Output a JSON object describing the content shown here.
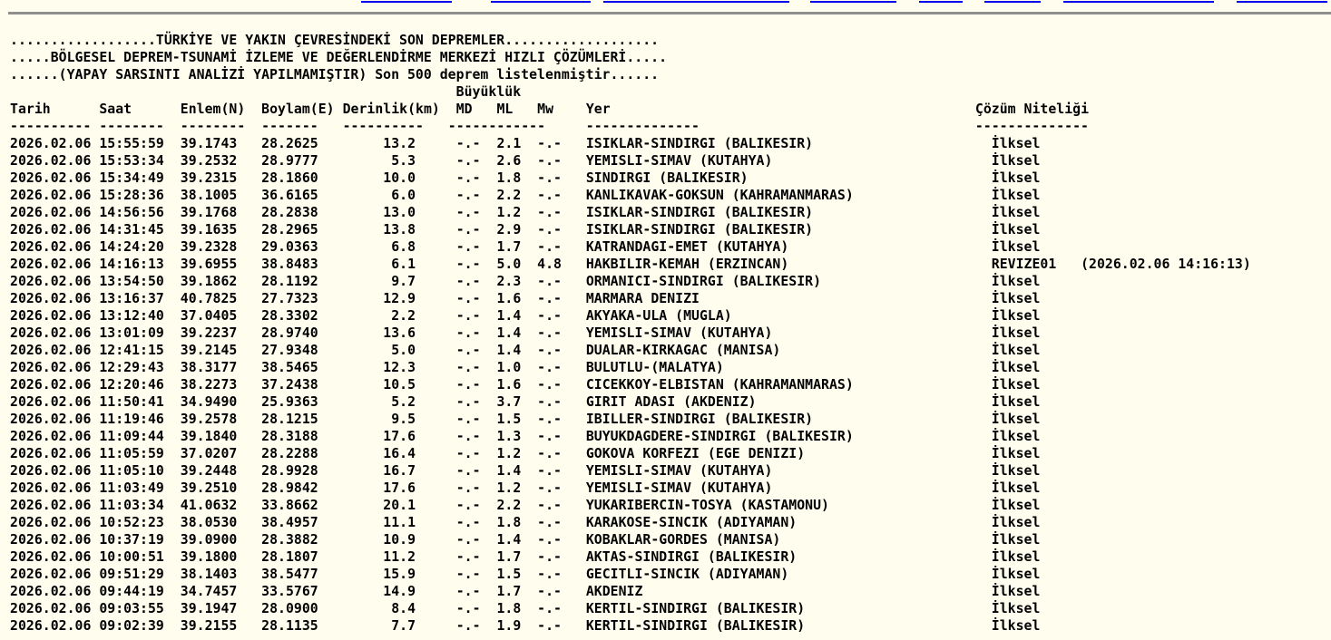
{
  "header": {
    "line1": "..................TÜRKİYE VE YAKIN ÇEVRESİNDEKİ SON DEPREMLER...................",
    "line2": ".....BÖLGESEL DEPREM-TSUNAMİ İZLEME VE DEĞERLENDİRME MERKEZİ HIZLI ÇÖZÜMLERİ.....",
    "line3": "......(YAPAY SARSINTI ANALİZİ YAPILMAMIŞTIR) Son 500 deprem listelenmiştir......"
  },
  "columns": {
    "magnitude_group": "Büyüklük",
    "tarih": "Tarih",
    "saat": "Saat",
    "enlem": "Enlem(N)",
    "boylam": "Boylam(E)",
    "derinlik": "Derinlik(km)",
    "md": "MD",
    "ml": "ML",
    "mw": "Mw",
    "yer": "Yer",
    "cozum": "Çözüm Niteliği"
  },
  "rows": [
    {
      "date": "2026.02.06",
      "time": "15:55:59",
      "lat": "39.1743",
      "lon": "28.2625",
      "depth": "13.2",
      "md": "-.-",
      "ml": "2.1",
      "mw": "-.-",
      "place": "ISIKLAR-SINDIRGI (BALIKESIR)",
      "quality": "İlksel"
    },
    {
      "date": "2026.02.06",
      "time": "15:53:34",
      "lat": "39.2532",
      "lon": "28.9777",
      "depth": "5.3",
      "md": "-.-",
      "ml": "2.6",
      "mw": "-.-",
      "place": "YEMISLI-SIMAV (KUTAHYA)",
      "quality": "İlksel"
    },
    {
      "date": "2026.02.06",
      "time": "15:34:49",
      "lat": "39.2315",
      "lon": "28.1860",
      "depth": "10.0",
      "md": "-.-",
      "ml": "1.8",
      "mw": "-.-",
      "place": "SINDIRGI (BALIKESIR)",
      "quality": "İlksel"
    },
    {
      "date": "2026.02.06",
      "time": "15:28:36",
      "lat": "38.1005",
      "lon": "36.6165",
      "depth": "6.0",
      "md": "-.-",
      "ml": "2.2",
      "mw": "-.-",
      "place": "KANLIKAVAK-GOKSUN (KAHRAMANMARAS)",
      "quality": "İlksel"
    },
    {
      "date": "2026.02.06",
      "time": "14:56:56",
      "lat": "39.1768",
      "lon": "28.2838",
      "depth": "13.0",
      "md": "-.-",
      "ml": "1.2",
      "mw": "-.-",
      "place": "ISIKLAR-SINDIRGI (BALIKESIR)",
      "quality": "İlksel"
    },
    {
      "date": "2026.02.06",
      "time": "14:31:45",
      "lat": "39.1635",
      "lon": "28.2965",
      "depth": "13.8",
      "md": "-.-",
      "ml": "2.9",
      "mw": "-.-",
      "place": "ISIKLAR-SINDIRGI (BALIKESIR)",
      "quality": "İlksel"
    },
    {
      "date": "2026.02.06",
      "time": "14:24:20",
      "lat": "39.2328",
      "lon": "29.0363",
      "depth": "6.8",
      "md": "-.-",
      "ml": "1.7",
      "mw": "-.-",
      "place": "KATRANDAGI-EMET (KUTAHYA)",
      "quality": "İlksel"
    },
    {
      "date": "2026.02.06",
      "time": "14:16:13",
      "lat": "39.6955",
      "lon": "38.8483",
      "depth": "6.1",
      "md": "-.-",
      "ml": "5.0",
      "mw": "4.8",
      "place": "HAKBILIR-KEMAH (ERZINCAN)",
      "quality": "REVIZE01   (2026.02.06 14:16:13)"
    },
    {
      "date": "2026.02.06",
      "time": "13:54:50",
      "lat": "39.1862",
      "lon": "28.1192",
      "depth": "9.7",
      "md": "-.-",
      "ml": "2.3",
      "mw": "-.-",
      "place": "ORMANICI-SINDIRGI (BALIKESIR)",
      "quality": "İlksel"
    },
    {
      "date": "2026.02.06",
      "time": "13:16:37",
      "lat": "40.7825",
      "lon": "27.7323",
      "depth": "12.9",
      "md": "-.-",
      "ml": "1.6",
      "mw": "-.-",
      "place": "MARMARA DENIZI",
      "quality": "İlksel"
    },
    {
      "date": "2026.02.06",
      "time": "13:12:40",
      "lat": "37.0405",
      "lon": "28.3302",
      "depth": "2.2",
      "md": "-.-",
      "ml": "1.4",
      "mw": "-.-",
      "place": "AKYAKA-ULA (MUGLA)",
      "quality": "İlksel"
    },
    {
      "date": "2026.02.06",
      "time": "13:01:09",
      "lat": "39.2237",
      "lon": "28.9740",
      "depth": "13.6",
      "md": "-.-",
      "ml": "1.4",
      "mw": "-.-",
      "place": "YEMISLI-SIMAV (KUTAHYA)",
      "quality": "İlksel"
    },
    {
      "date": "2026.02.06",
      "time": "12:41:15",
      "lat": "39.2145",
      "lon": "27.9348",
      "depth": "5.0",
      "md": "-.-",
      "ml": "1.4",
      "mw": "-.-",
      "place": "DUALAR-KIRKAGAC (MANISA)",
      "quality": "İlksel"
    },
    {
      "date": "2026.02.06",
      "time": "12:29:43",
      "lat": "38.3177",
      "lon": "38.5465",
      "depth": "12.3",
      "md": "-.-",
      "ml": "1.0",
      "mw": "-.-",
      "place": "BULUTLU-(MALATYA)",
      "quality": "İlksel"
    },
    {
      "date": "2026.02.06",
      "time": "12:20:46",
      "lat": "38.2273",
      "lon": "37.2438",
      "depth": "10.5",
      "md": "-.-",
      "ml": "1.6",
      "mw": "-.-",
      "place": "CICEKKOY-ELBISTAN (KAHRAMANMARAS)",
      "quality": "İlksel"
    },
    {
      "date": "2026.02.06",
      "time": "11:50:41",
      "lat": "34.9490",
      "lon": "25.9363",
      "depth": "5.2",
      "md": "-.-",
      "ml": "3.7",
      "mw": "-.-",
      "place": "GIRIT ADASI (AKDENIZ)",
      "quality": "İlksel"
    },
    {
      "date": "2026.02.06",
      "time": "11:19:46",
      "lat": "39.2578",
      "lon": "28.1215",
      "depth": "9.5",
      "md": "-.-",
      "ml": "1.5",
      "mw": "-.-",
      "place": "IBILLER-SINDIRGI (BALIKESIR)",
      "quality": "İlksel"
    },
    {
      "date": "2026.02.06",
      "time": "11:09:44",
      "lat": "39.1840",
      "lon": "28.3188",
      "depth": "17.6",
      "md": "-.-",
      "ml": "1.3",
      "mw": "-.-",
      "place": "BUYUKDAGDERE-SINDIRGI (BALIKESIR)",
      "quality": "İlksel"
    },
    {
      "date": "2026.02.06",
      "time": "11:05:59",
      "lat": "37.0207",
      "lon": "28.2288",
      "depth": "16.4",
      "md": "-.-",
      "ml": "1.2",
      "mw": "-.-",
      "place": "GOKOVA KORFEZI (EGE DENIZI)",
      "quality": "İlksel"
    },
    {
      "date": "2026.02.06",
      "time": "11:05:10",
      "lat": "39.2448",
      "lon": "28.9928",
      "depth": "16.7",
      "md": "-.-",
      "ml": "1.4",
      "mw": "-.-",
      "place": "YEMISLI-SIMAV (KUTAHYA)",
      "quality": "İlksel"
    },
    {
      "date": "2026.02.06",
      "time": "11:03:49",
      "lat": "39.2510",
      "lon": "28.9842",
      "depth": "17.6",
      "md": "-.-",
      "ml": "1.2",
      "mw": "-.-",
      "place": "YEMISLI-SIMAV (KUTAHYA)",
      "quality": "İlksel"
    },
    {
      "date": "2026.02.06",
      "time": "11:03:34",
      "lat": "41.0632",
      "lon": "33.8662",
      "depth": "20.1",
      "md": "-.-",
      "ml": "2.2",
      "mw": "-.-",
      "place": "YUKARIBERCIN-TOSYA (KASTAMONU)",
      "quality": "İlksel"
    },
    {
      "date": "2026.02.06",
      "time": "10:52:23",
      "lat": "38.0530",
      "lon": "38.4957",
      "depth": "11.1",
      "md": "-.-",
      "ml": "1.8",
      "mw": "-.-",
      "place": "KARAKOSE-SINCIK (ADIYAMAN)",
      "quality": "İlksel"
    },
    {
      "date": "2026.02.06",
      "time": "10:37:19",
      "lat": "39.0900",
      "lon": "28.3882",
      "depth": "10.9",
      "md": "-.-",
      "ml": "1.4",
      "mw": "-.-",
      "place": "KOBAKLAR-GORDES (MANISA)",
      "quality": "İlksel"
    },
    {
      "date": "2026.02.06",
      "time": "10:00:51",
      "lat": "39.1800",
      "lon": "28.1807",
      "depth": "11.2",
      "md": "-.-",
      "ml": "1.7",
      "mw": "-.-",
      "place": "AKTAS-SINDIRGI (BALIKESIR)",
      "quality": "İlksel"
    },
    {
      "date": "2026.02.06",
      "time": "09:51:29",
      "lat": "38.1403",
      "lon": "38.5477",
      "depth": "15.9",
      "md": "-.-",
      "ml": "1.5",
      "mw": "-.-",
      "place": "GECITLI-SINCIK (ADIYAMAN)",
      "quality": "İlksel"
    },
    {
      "date": "2026.02.06",
      "time": "09:44:19",
      "lat": "34.7457",
      "lon": "33.5767",
      "depth": "14.9",
      "md": "-.-",
      "ml": "1.7",
      "mw": "-.-",
      "place": "AKDENIZ",
      "quality": "İlksel"
    },
    {
      "date": "2026.02.06",
      "time": "09:03:55",
      "lat": "39.1947",
      "lon": "28.0900",
      "depth": "8.4",
      "md": "-.-",
      "ml": "1.8",
      "mw": "-.-",
      "place": "KERTIL-SINDIRGI (BALIKESIR)",
      "quality": "İlksel"
    },
    {
      "date": "2026.02.06",
      "time": "09:02:39",
      "lat": "39.2155",
      "lon": "28.1135",
      "depth": "7.7",
      "md": "-.-",
      "ml": "1.9",
      "mw": "-.-",
      "place": "KERTIL-SINDIRGI (BALIKESIR)",
      "quality": "İlksel"
    }
  ]
}
